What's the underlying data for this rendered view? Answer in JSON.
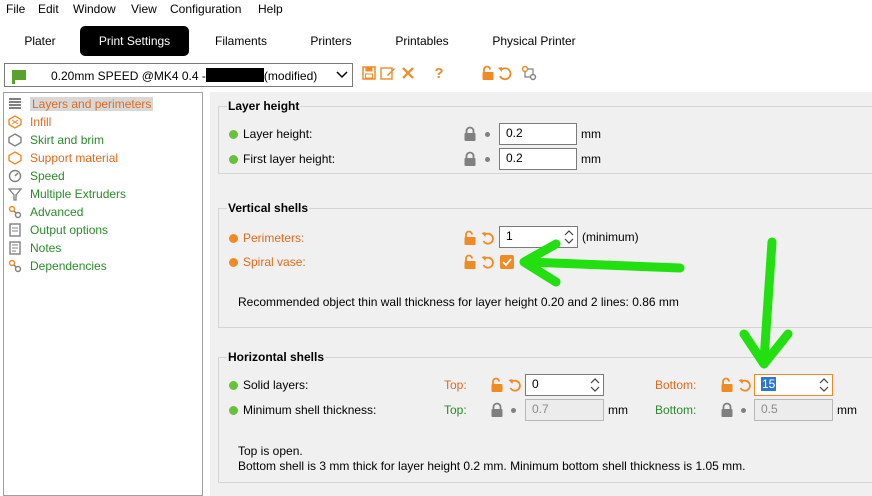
{
  "menu": {
    "items": [
      "File",
      "Edit",
      "Window",
      "View",
      "Configuration",
      "Help"
    ]
  },
  "tabs": [
    "Plater",
    "Print Settings",
    "Filaments",
    "Printers",
    "Printables",
    "Physical Printer"
  ],
  "preset": {
    "name_prefix": "0.20mm SPEED @MK4 0.4 -",
    "modified": "(modified)"
  },
  "toolbar": {
    "icons": [
      "save-icon",
      "edit-icon",
      "delete-icon",
      "help-icon",
      "lock-icon",
      "undo-icon",
      "compare-icon"
    ],
    "help_glyph": "?"
  },
  "sidebar": {
    "items": [
      {
        "label": "Layers and perimeters",
        "icon": "layers-icon"
      },
      {
        "label": "Infill",
        "icon": "infill-icon"
      },
      {
        "label": "Skirt and brim",
        "icon": "skirt-icon"
      },
      {
        "label": "Support material",
        "icon": "support-icon"
      },
      {
        "label": "Speed",
        "icon": "speed-icon"
      },
      {
        "label": "Multiple Extruders",
        "icon": "extruders-icon"
      },
      {
        "label": "Advanced",
        "icon": "advanced-icon"
      },
      {
        "label": "Output options",
        "icon": "output-icon"
      },
      {
        "label": "Notes",
        "icon": "notes-icon"
      },
      {
        "label": "Dependencies",
        "icon": "dependencies-icon"
      }
    ]
  },
  "layer_height": {
    "title": "Layer height",
    "layer_height_label": "Layer height:",
    "layer_height_value": "0.2",
    "first_layer_label": "First layer height:",
    "first_layer_value": "0.2",
    "unit": "mm"
  },
  "vertical_shells": {
    "title": "Vertical shells",
    "perimeters_label": "Perimeters:",
    "perimeters_value": "1",
    "perimeters_suffix": "(minimum)",
    "spiral_label": "Spiral vase:",
    "spiral_checked": true,
    "note": "Recommended object thin wall thickness for layer height 0.20 and 2 lines: 0.86 mm"
  },
  "horizontal_shells": {
    "title": "Horizontal shells",
    "solid_label": "Solid layers:",
    "top_label": "Top:",
    "top_value": "0",
    "bottom_label": "Bottom:",
    "bottom_value": "15",
    "min_shell_label": "Minimum shell thickness:",
    "min_top_value": "0.7",
    "min_bottom_value": "0.5",
    "unit": "mm",
    "note1": "Top is open.",
    "note2": "Bottom shell is 3 mm thick for layer height 0.2 mm. Minimum bottom shell thickness is 1.05 mm."
  },
  "colors": {
    "green": "#67c23a",
    "orange": "#f08a24",
    "annotation_arrow": "#22e010",
    "selection": "#3077c9"
  }
}
